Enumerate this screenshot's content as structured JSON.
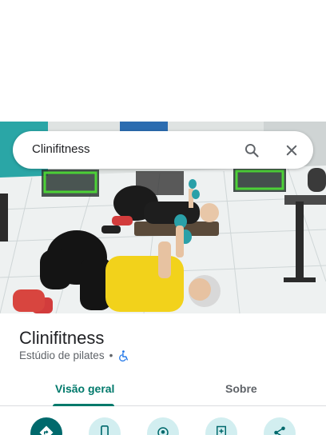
{
  "search": {
    "query": "Clinifitness"
  },
  "place": {
    "name": "Clinifitness",
    "category": "Estúdio de pilates",
    "separator": "•"
  },
  "tabs": [
    {
      "label": "Visão geral",
      "active": true
    },
    {
      "label": "Sobre",
      "active": false
    }
  ],
  "actions": [
    {
      "icon": "directions-icon",
      "primary": true
    },
    {
      "icon": "phone-icon",
      "primary": false
    },
    {
      "icon": "location-icon",
      "primary": false
    },
    {
      "icon": "save-icon",
      "primary": false
    },
    {
      "icon": "share-icon",
      "primary": false
    }
  ],
  "colors": {
    "accent": "#00796b",
    "primary_button": "#00696c",
    "secondary_button": "#d2eef0",
    "a11y_icon": "#1a73e8"
  }
}
